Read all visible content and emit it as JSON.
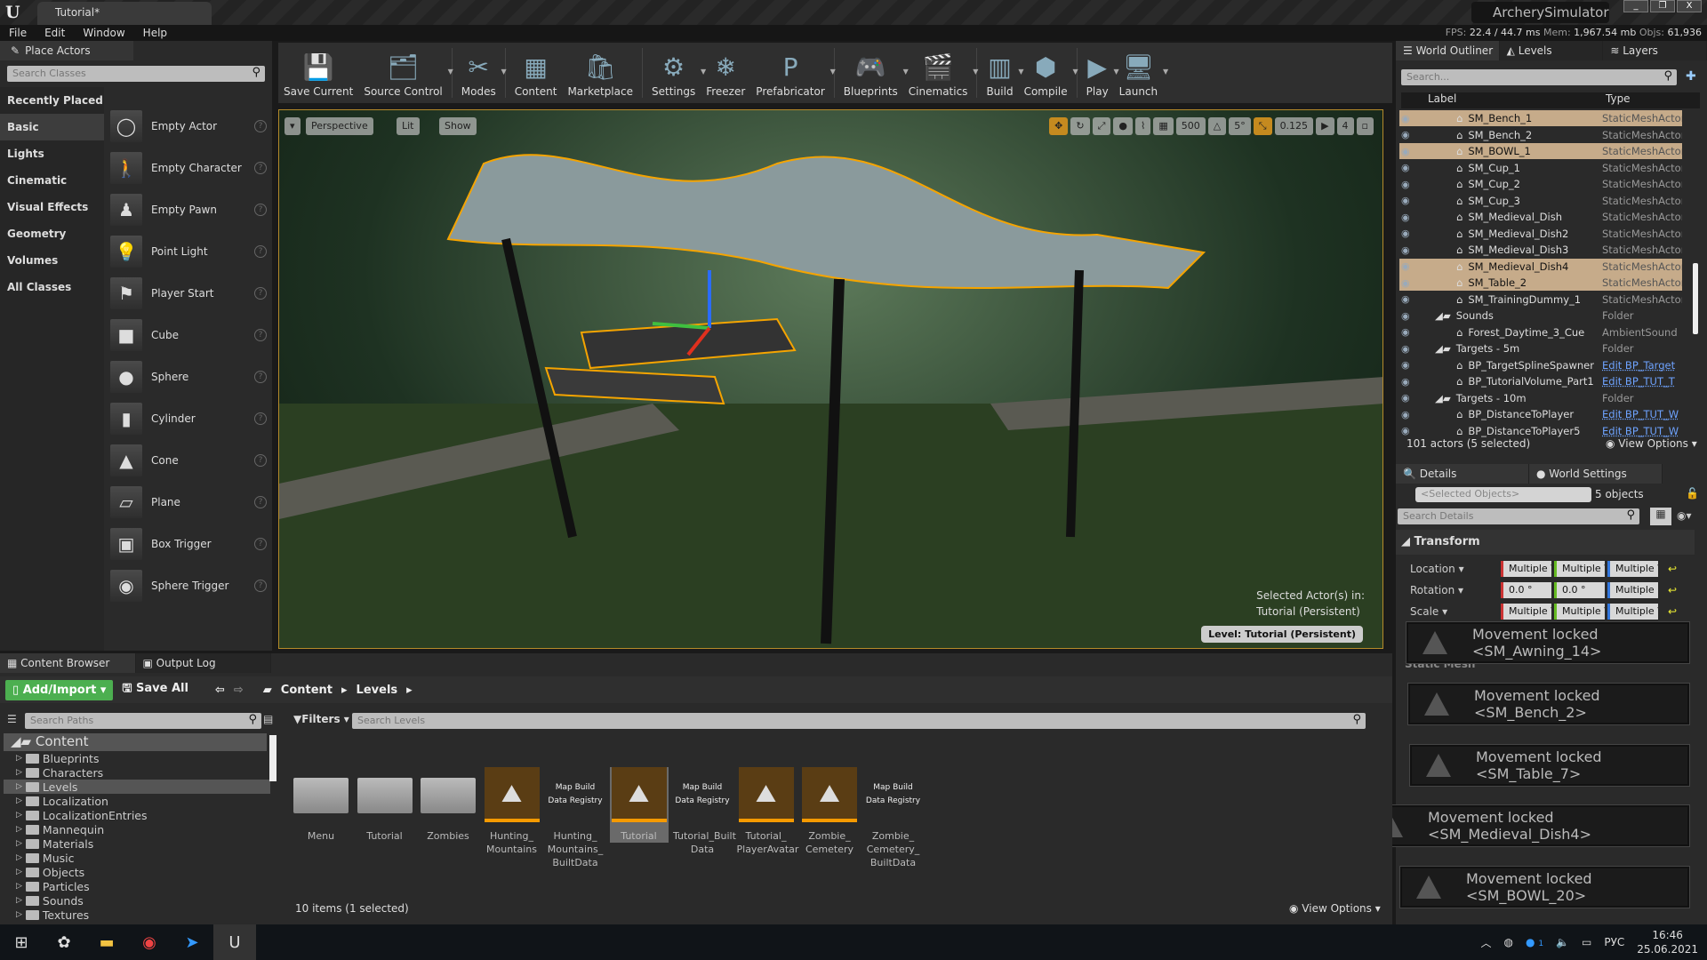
{
  "window": {
    "doc_tab": "Tutorial*",
    "project": "ArcherySimulator",
    "minimize": "_",
    "restore": "❐",
    "close": "X"
  },
  "menu": [
    "File",
    "Edit",
    "Window",
    "Help"
  ],
  "stats": {
    "fps_label": "FPS:",
    "fps": "22.4",
    "ms": "/ 44.7 ms",
    "mem_label": "Mem:",
    "mem": "1,967.54 mb",
    "objs_label": "Objs:",
    "objs": "61,936"
  },
  "place_actors": {
    "tab": "Place Actors",
    "search_placeholder": "Search Classes",
    "categories": [
      "Recently Placed",
      "Basic",
      "Lights",
      "Cinematic",
      "Visual Effects",
      "Geometry",
      "Volumes",
      "All Classes"
    ],
    "selected_category": "Basic",
    "actors": [
      "Empty Actor",
      "Empty Character",
      "Empty Pawn",
      "Point Light",
      "Player Start",
      "Cube",
      "Sphere",
      "Cylinder",
      "Cone",
      "Plane",
      "Box Trigger",
      "Sphere Trigger"
    ]
  },
  "toolbar": [
    "Save Current",
    "Source Control",
    "Modes",
    "Content",
    "Marketplace",
    "Settings",
    "Freezer",
    "Prefabricator",
    "Blueprints",
    "Cinematics",
    "Build",
    "Compile",
    "Play",
    "Launch"
  ],
  "viewport": {
    "perspective": "Perspective",
    "lit": "Lit",
    "show": "Show",
    "grid": "500",
    "angle": "5°",
    "scale": "0.125",
    "camera_speed": "4",
    "selected_in": "Selected Actor(s) in:",
    "level_name": "Tutorial (Persistent)",
    "level_badge": "Level:  Tutorial (Persistent)"
  },
  "outliner": {
    "tabs": [
      "World Outliner",
      "Levels",
      "Layers"
    ],
    "search_placeholder": "Search...",
    "col_label": "Label",
    "col_type": "Type",
    "rows": [
      {
        "name": "SM_Bench_1",
        "type": "StaticMeshActor",
        "selected": true,
        "indent": 2
      },
      {
        "name": "SM_Bench_2",
        "type": "StaticMeshActor",
        "selected": false,
        "indent": 2
      },
      {
        "name": "SM_BOWL_1",
        "type": "StaticMeshActor",
        "selected": true,
        "indent": 2
      },
      {
        "name": "SM_Cup_1",
        "type": "StaticMeshActor",
        "selected": false,
        "indent": 2
      },
      {
        "name": "SM_Cup_2",
        "type": "StaticMeshActor",
        "selected": false,
        "indent": 2
      },
      {
        "name": "SM_Cup_3",
        "type": "StaticMeshActor",
        "selected": false,
        "indent": 2
      },
      {
        "name": "SM_Medieval_Dish",
        "type": "StaticMeshActor",
        "selected": false,
        "indent": 2
      },
      {
        "name": "SM_Medieval_Dish2",
        "type": "StaticMeshActor",
        "selected": false,
        "indent": 2
      },
      {
        "name": "SM_Medieval_Dish3",
        "type": "StaticMeshActor",
        "selected": false,
        "indent": 2
      },
      {
        "name": "SM_Medieval_Dish4",
        "type": "StaticMeshActor",
        "selected": true,
        "indent": 2
      },
      {
        "name": "SM_Table_2",
        "type": "StaticMeshActor",
        "selected": true,
        "indent": 2
      },
      {
        "name": "SM_TrainingDummy_1",
        "type": "StaticMeshActor",
        "selected": false,
        "indent": 2
      },
      {
        "name": "Sounds",
        "type": "Folder",
        "selected": false,
        "indent": 1,
        "folder": true
      },
      {
        "name": "Forest_Daytime_3_Cue",
        "type": "AmbientSound",
        "selected": false,
        "indent": 2
      },
      {
        "name": "Targets - 5m",
        "type": "Folder",
        "selected": false,
        "indent": 1,
        "folder": true
      },
      {
        "name": "BP_TargetSplineSpawner",
        "type": "Edit BP_Target",
        "selected": false,
        "indent": 2,
        "link": true
      },
      {
        "name": "BP_TutorialVolume_Part1",
        "type": "Edit BP_TUT_T",
        "selected": false,
        "indent": 2,
        "link": true
      },
      {
        "name": "Targets - 10m",
        "type": "Folder",
        "selected": false,
        "indent": 1,
        "folder": true
      },
      {
        "name": "BP_DistanceToPlayer",
        "type": "Edit BP_TUT_W",
        "selected": false,
        "indent": 2,
        "link": true
      },
      {
        "name": "BP_DistanceToPlayer5",
        "type": "Edit BP_TUT_W",
        "selected": false,
        "indent": 2,
        "link": true
      }
    ],
    "footer": "101 actors (5 selected)",
    "view_options": "View Options"
  },
  "details": {
    "tabs": [
      "Details",
      "World Settings"
    ],
    "selected_placeholder": "<Selected Objects>",
    "count": "5 objects",
    "search_placeholder": "Search Details",
    "section": "Transform",
    "next_section": "Static Mesh",
    "props": [
      {
        "label": "Location",
        "x": "Multiple V",
        "y": "Multiple V",
        "z": "Multiple V"
      },
      {
        "label": "Rotation",
        "x": "0.0 °",
        "y": "0.0 °",
        "z": "Multiple"
      },
      {
        "label": "Scale",
        "x": "Multiple V",
        "y": "Multiple V",
        "z": "Multiple V"
      }
    ]
  },
  "toasts": [
    "Movement locked <SM_Awning_14>",
    "Movement locked <SM_Bench_2>",
    "Movement locked <SM_Table_7>",
    "Movement locked <SM_Medieval_Dish4>",
    "Movement locked <SM_BOWL_20>"
  ],
  "content_browser": {
    "tabs": [
      "Content Browser",
      "Output Log"
    ],
    "add_import": "Add/Import",
    "save_all": "Save All",
    "path": [
      "Content",
      "Levels"
    ],
    "search_paths_placeholder": "Search Paths",
    "filters": "Filters",
    "search_placeholder": "Search Levels",
    "tree_root": "Content",
    "tree": [
      "Blueprints",
      "Characters",
      "Levels",
      "Localization",
      "LocalizationEntries",
      "Mannequin",
      "Materials",
      "Music",
      "Objects",
      "Particles",
      "Sounds",
      "Textures"
    ],
    "tree_selected": "Levels",
    "assets": [
      {
        "name": "Menu",
        "kind": "folder"
      },
      {
        "name": "Tutorial",
        "kind": "folder"
      },
      {
        "name": "Zombies",
        "kind": "folder"
      },
      {
        "name": "Hunting_ Mountains",
        "kind": "map"
      },
      {
        "name": "Hunting_ Mountains_ BuiltData",
        "kind": "registry"
      },
      {
        "name": "Tutorial",
        "kind": "map",
        "selected": true
      },
      {
        "name": "Tutorial_Built Data",
        "kind": "registry"
      },
      {
        "name": "Tutorial_ PlayerAvatar",
        "kind": "map"
      },
      {
        "name": "Zombie_ Cemetery",
        "kind": "map"
      },
      {
        "name": "Zombie_ Cemetery_ BuiltData",
        "kind": "registry"
      }
    ],
    "registry_label": "Map Build Data Registry",
    "status": "10 items (1 selected)",
    "view_options": "View Options"
  },
  "taskbar": {
    "lang": "РУС",
    "time": "16:46",
    "date": "25.06.2021",
    "badge": "1"
  },
  "colors": {
    "accent_orange": "#f59a00",
    "selection": "#c6ab8a",
    "add_import_green": "#4caf50",
    "link_blue": "#6ea3ff"
  }
}
